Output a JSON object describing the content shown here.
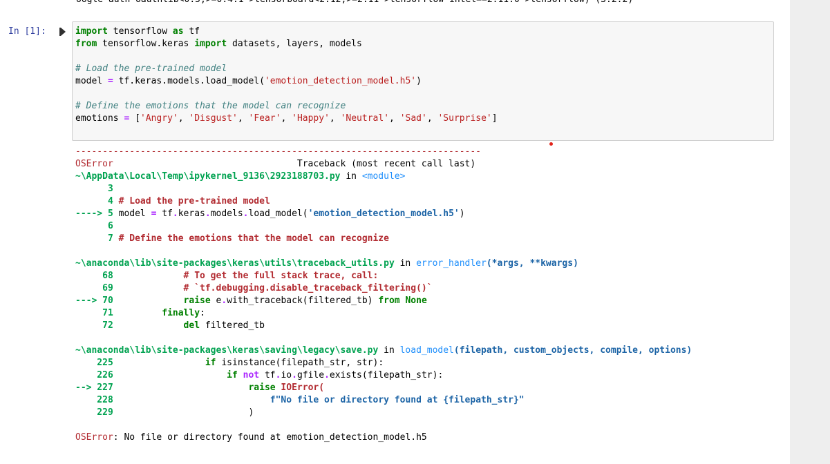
{
  "previous_output": {
    "text": "oogle-auth-oauthlib<0.5,>=0.4.1->tensorboard<2.12,>=2.11->tensorflow-intel==2.11.0->tensorflow) (3.2.2)"
  },
  "cell": {
    "prompt": "In [1]:",
    "code": {
      "l1_kw1": "import",
      "l1_mod": " tensorflow ",
      "l1_kw2": "as",
      "l1_alias": " tf",
      "l2_kw1": "from",
      "l2_mod": " tensorflow.keras ",
      "l2_kw2": "import",
      "l2_rest": " datasets, layers, models",
      "l4_comment": "# Load the pre-trained model",
      "l5_a": "model ",
      "l5_eq": "=",
      "l5_b": " tf.keras.models.load_model(",
      "l5_str": "'emotion_detection_model.h5'",
      "l5_c": ")",
      "l7_comment": "# Define the emotions that the model can recognize",
      "l8_a": "emotions ",
      "l8_eq": "=",
      "l8_b": " [",
      "l8_s1": "'Angry'",
      "l8_s2": "'Disgust'",
      "l8_s3": "'Fear'",
      "l8_s4": "'Happy'",
      "l8_s5": "'Neutral'",
      "l8_s6": "'Sad'",
      "l8_s7": "'Surprise'",
      "l8_sep": ", ",
      "l8_end": "]"
    }
  },
  "traceback": {
    "dashes": "---------------------------------------------------------------------------",
    "err_name": "OSError",
    "header_right": "Traceback (most recent call last)",
    "frame1": {
      "path": "~\\AppData\\Local\\Temp\\ipykernel_9136\\2923188703.py",
      "in": " in ",
      "func": "<module>",
      "lines": [
        {
          "n": "      3",
          "t": ""
        },
        {
          "n": "      4",
          "t": " # Load the pre-trained model"
        },
        {
          "arrow": "----> 5",
          "a": " model ",
          "eq": "=",
          "b": " tf",
          "dot1": ".",
          "c": "keras",
          "dot2": ".",
          "d": "models",
          "dot3": ".",
          "e": "load_model(",
          "s": "'emotion_detection_model.h5'",
          "f": ")"
        },
        {
          "n": "      6",
          "t": ""
        },
        {
          "n": "      7",
          "t": " # Define the emotions that the model can recognize"
        }
      ]
    },
    "frame2": {
      "path": "~\\anaconda\\lib\\site-packages\\keras\\utils\\traceback_utils.py",
      "in": " in ",
      "func": "error_handler",
      "args": "(*args, **kwargs)",
      "l68n": "     68",
      "l68t": "             # To get the full stack trace, call:",
      "l69n": "     69",
      "l69t": "             # `tf.debugging.disable_traceback_filtering()`",
      "l70arrow": "---> 70",
      "l70pad": "             ",
      "l70raise": "raise",
      "l70a": " e",
      "l70dot": ".",
      "l70b": "with_traceback(filtered_tb) ",
      "l70from": "from",
      "l70none": " None",
      "l71n": "     71",
      "l71pad": "         ",
      "l71t": "finally",
      "l71c": ":",
      "l72n": "     72",
      "l72pad": "             ",
      "l72del": "del",
      "l72t": " filtered_tb"
    },
    "frame3": {
      "path": "~\\anaconda\\lib\\site-packages\\keras\\saving\\legacy\\save.py",
      "in": " in ",
      "func": "load_model",
      "args": "(filepath, custom_objects, compile, options)",
      "l225n": "    225",
      "l225pad": "                 ",
      "l225if": "if",
      "l225t": " isinstance(filepath_str, str)",
      "l225c": ":",
      "l226n": "    226",
      "l226pad": "                     ",
      "l226if": "if",
      "l226not": " not",
      "l226t": " tf",
      "l226d1": ".",
      "l226t2": "io",
      "l226d2": ".",
      "l226t3": "gfile",
      "l226d3": ".",
      "l226t4": "exists(filepath_str)",
      "l226c": ":",
      "l227arrow": "--> 227",
      "l227pad": "                         ",
      "l227raise": "raise",
      "l227t": " IOError(",
      "l228n": "    228",
      "l228pad": "                             ",
      "l228s": "f\"No file or directory found at {filepath_str}\"",
      "l229n": "    229",
      "l229pad": "                         ",
      "l229t": ")"
    },
    "final_name": "OSError",
    "final_msg": ": No file or directory found at emotion_detection_model.h5"
  }
}
